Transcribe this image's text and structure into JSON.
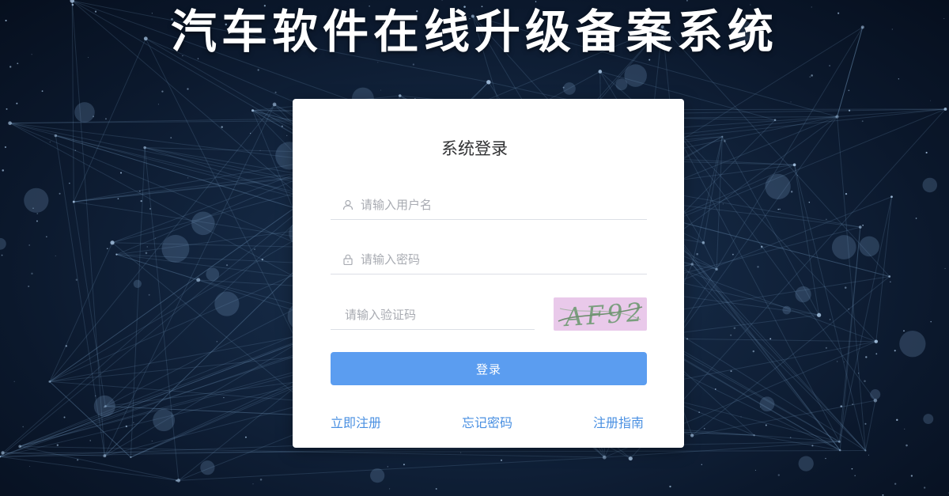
{
  "page": {
    "title": "汽车软件在线升级备案系统",
    "colors": {
      "background": "#0b182c",
      "accent": "#5b9df0",
      "link": "#4a90e2",
      "captcha_bg": "#e9c9ea",
      "captcha_text": "#7a9e7e"
    }
  },
  "login": {
    "title": "系统登录",
    "username": {
      "placeholder": "请输入用户名",
      "value": "",
      "icon": "user-icon"
    },
    "password": {
      "placeholder": "请输入密码",
      "value": "",
      "icon": "lock-icon"
    },
    "captcha_input": {
      "placeholder": "请输入验证码",
      "value": ""
    },
    "captcha_image_text": "AF92",
    "submit_label": "登录"
  },
  "links": {
    "register": "立即注册",
    "forgot_password": "忘记密码",
    "guide": "注册指南"
  }
}
